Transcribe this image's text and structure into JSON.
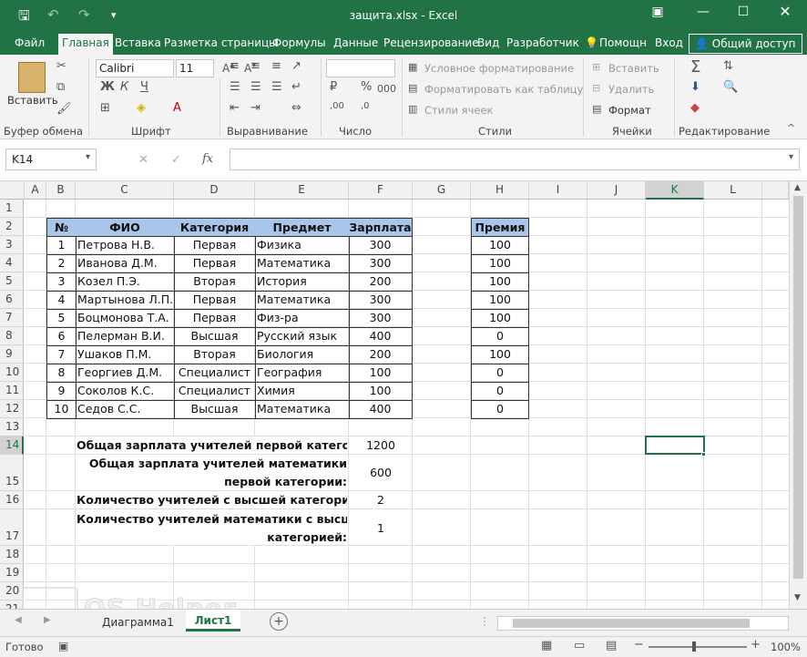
{
  "window": {
    "title": "защита.xlsx - Excel"
  },
  "tabs": [
    "Файл",
    "Главная",
    "Вставка",
    "Разметка страницы",
    "Формулы",
    "Данные",
    "Рецензирование",
    "Вид",
    "Разработчик",
    "Помощн",
    "Вход",
    "Общий доступ"
  ],
  "ribbon": {
    "clipboard": {
      "label": "Буфер обмена",
      "paste": "Вставить"
    },
    "font": {
      "label": "Шрифт",
      "name": "Calibri",
      "size": "11",
      "bold": "Ж",
      "italic": "К",
      "underline": "Ч"
    },
    "alignment": {
      "label": "Выравнивание"
    },
    "number": {
      "label": "Число",
      "percent": "%",
      "thousands": "000"
    },
    "styles": {
      "label": "Стили",
      "cond": "Условное форматирование",
      "table": "Форматировать как таблицу",
      "cell": "Стили ячеек"
    },
    "cells": {
      "label": "Ячейки",
      "insert": "Вставить",
      "delete": "Удалить",
      "format": "Формат"
    },
    "editing": {
      "label": "Редактирование"
    }
  },
  "formula": {
    "namebox": "K14",
    "fx": "fx",
    "value": ""
  },
  "columns": [
    "A",
    "B",
    "C",
    "D",
    "E",
    "F",
    "G",
    "H",
    "I",
    "J",
    "K",
    "L"
  ],
  "rows": [
    "1",
    "2",
    "3",
    "4",
    "5",
    "6",
    "7",
    "8",
    "9",
    "10",
    "11",
    "12",
    "13",
    "14",
    "15",
    "16",
    "17",
    "18",
    "19",
    "20",
    "21"
  ],
  "table": {
    "headers": [
      "№",
      "ФИО",
      "Категория",
      "Предмет",
      "Зарплата"
    ],
    "rows": [
      [
        "1",
        "Петрова Н.В.",
        "Первая",
        "Физика",
        "300"
      ],
      [
        "2",
        "Иванова Д.М.",
        "Первая",
        "Математика",
        "300"
      ],
      [
        "3",
        "Козел П.Э.",
        "Вторая",
        "История",
        "200"
      ],
      [
        "4",
        "Мартынова Л.П.",
        "Первая",
        "Математика",
        "300"
      ],
      [
        "5",
        "Боцмонова Т.А.",
        "Первая",
        "Физ-ра",
        "300"
      ],
      [
        "6",
        "Пелерман В.И.",
        "Высшая",
        "Русский язык",
        "400"
      ],
      [
        "7",
        "Ушаков П.М.",
        "Вторая",
        "Биология",
        "200"
      ],
      [
        "8",
        "Георгиев Д.М.",
        "Специалист",
        "География",
        "100"
      ],
      [
        "9",
        "Соколов К.С.",
        "Специалист",
        "Химия",
        "100"
      ],
      [
        "10",
        "Седов С.С.",
        "Высшая",
        "Математика",
        "400"
      ]
    ]
  },
  "premium": {
    "header": "Премия",
    "values": [
      "100",
      "100",
      "100",
      "100",
      "100",
      "0",
      "100",
      "0",
      "0",
      "0"
    ]
  },
  "summary": [
    {
      "line1": "Общая зарплата учителей первой категории:",
      "line2": "",
      "value": "1200"
    },
    {
      "line1": "Общая зарплата учителей математики",
      "line2": "первой категории:",
      "value": "600"
    },
    {
      "line1": "Количество учителей с высшей категорией:",
      "line2": "",
      "value": "2"
    },
    {
      "line1": "Количество учителей математики с высшей",
      "line2": "категорией:",
      "value": "1"
    }
  ],
  "sheets": [
    "Диаграмма1",
    "Лист1"
  ],
  "status": {
    "ready": "Готово",
    "zoom": "100%"
  },
  "watermark": "OS Helper"
}
